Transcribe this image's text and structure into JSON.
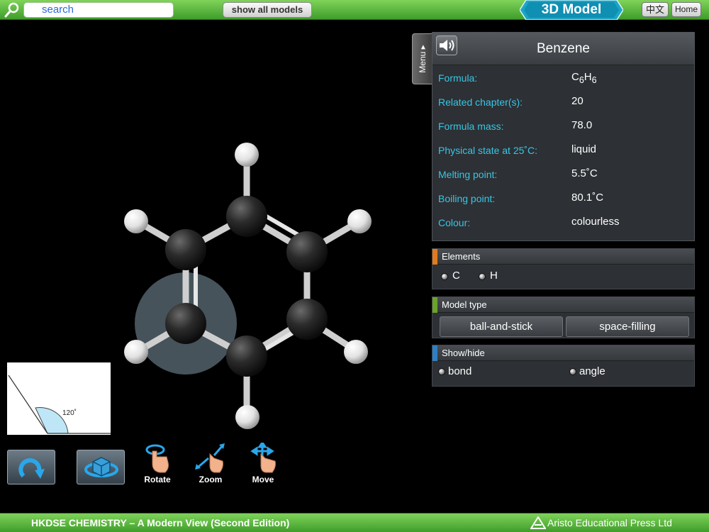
{
  "header": {
    "search_placeholder": "search",
    "show_all_label": "show all models",
    "title": "3D Model",
    "lang_label": "中文",
    "home_label": "Home"
  },
  "menu_tab": {
    "label": "Menu ▸"
  },
  "info": {
    "title": "Benzene",
    "formula_html": "C<sub>6</sub>H<sub>6</sub>",
    "rows": [
      {
        "label": "Formula:",
        "value": ""
      },
      {
        "label": "Related chapter(s):",
        "value": "20"
      },
      {
        "label": "Formula mass:",
        "value": "78.0"
      },
      {
        "label": "Physical state at 25˚C:",
        "value": "liquid"
      },
      {
        "label": "Melting point:",
        "value": "5.5˚C"
      },
      {
        "label": "Boiling point:",
        "value": "80.1˚C"
      },
      {
        "label": "Colour:",
        "value": "colourless"
      }
    ]
  },
  "elements": {
    "title": "Elements",
    "color": "#e07a1c",
    "items": [
      "C",
      "H"
    ]
  },
  "model_type": {
    "title": "Model type",
    "color": "#6aa22b",
    "options": [
      "ball-and-stick",
      "space-filling"
    ]
  },
  "show_hide": {
    "title": "Show/hide",
    "color": "#2f7fc4",
    "options": [
      "bond",
      "angle"
    ]
  },
  "angle_inset": {
    "label": "120˚"
  },
  "tools": {
    "rotate": "Rotate",
    "zoom": "Zoom",
    "move": "Move"
  },
  "footer": {
    "left": "HKDSE CHEMISTRY – A Modern View (Second Edition)",
    "right": "Aristo Educational Press Ltd"
  }
}
